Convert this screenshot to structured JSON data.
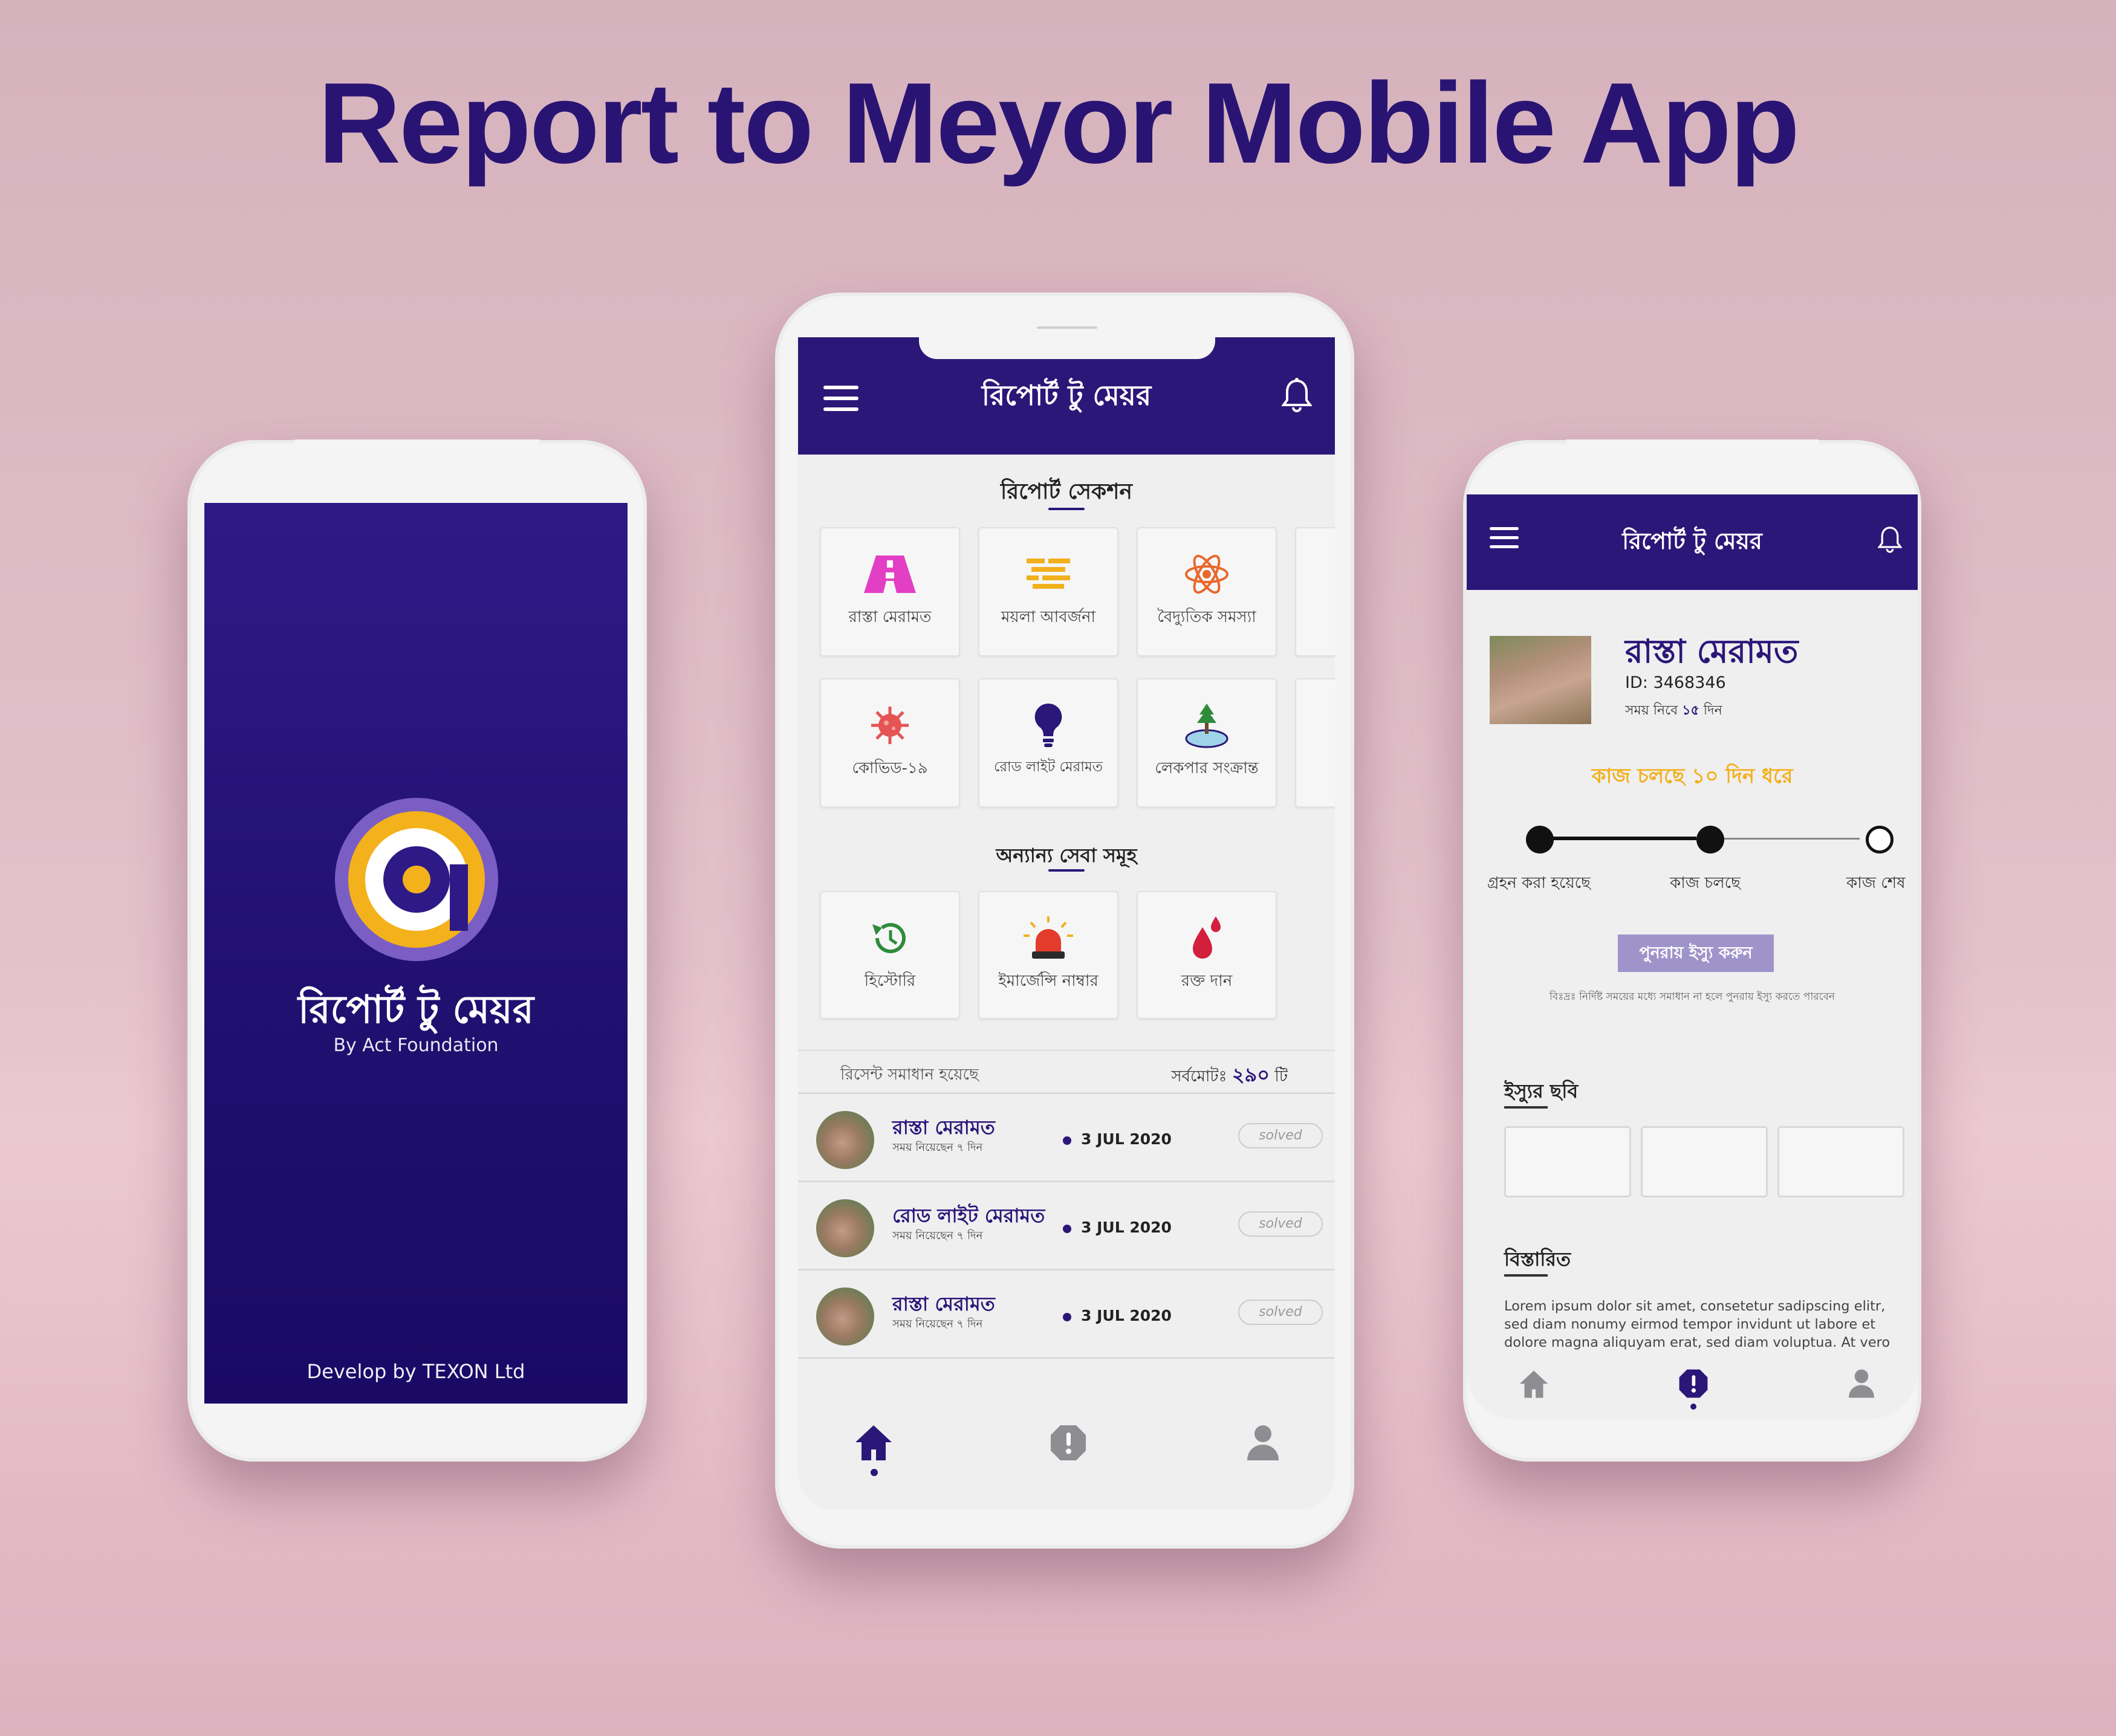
{
  "page": {
    "title": "Report to Meyor Mobile App"
  },
  "splash": {
    "app_name": "রিপোর্ট টু মেয়র",
    "by_line": "By Act Foundation",
    "developer": "Develop by TEXON Ltd",
    "colors": {
      "background": "#2e1a86",
      "logo_ring": "#f3b11b"
    }
  },
  "home": {
    "app_title": "রিপোর্ট টু মেয়র",
    "report_section_title": "রিপোর্ট সেকশন",
    "report_tiles": [
      {
        "label": "রাস্তা মেরামত",
        "icon": "road-icon"
      },
      {
        "label": "ময়লা আবর্জনা",
        "icon": "garbage-icon"
      },
      {
        "label": "বৈদ্যুতিক সমস্যা",
        "icon": "electric-atom-icon"
      },
      {
        "label": "কোভিড-১৯",
        "icon": "virus-icon"
      },
      {
        "label": "রোড লাইট মেরামত",
        "icon": "bulb-icon"
      },
      {
        "label": "লেকপার সংক্রান্ত",
        "icon": "lake-tree-icon"
      }
    ],
    "other_section_title": "অন্যান্য সেবা সমূহ",
    "other_tiles": [
      {
        "label": "হিস্টোরি",
        "icon": "history-icon"
      },
      {
        "label": "ইমার্জেন্সি নাম্বার",
        "icon": "siren-icon"
      },
      {
        "label": "রক্ত দান",
        "icon": "blood-drop-icon"
      }
    ],
    "recent_label": "রিসেন্ট সমাধান হয়েছে",
    "total_label": "সর্বমোটঃ",
    "total_value": "২৯০",
    "total_unit": "টি",
    "recent_items": [
      {
        "name": "রাস্তা মেরামত",
        "sub": "সময় নিয়েছেন ৭ দিন",
        "date": "3 JUL 2020",
        "status": "solved"
      },
      {
        "name": "রোড লাইট মেরামত",
        "sub": "সময় নিয়েছেন ৭ দিন",
        "date": "3 JUL 2020",
        "status": "solved"
      },
      {
        "name": "রাস্তা মেরামত",
        "sub": "সময় নিয়েছেন ৭ দিন",
        "date": "3 JUL 2020",
        "status": "solved"
      }
    ],
    "colors": {
      "primary": "#2b1778"
    }
  },
  "detail": {
    "app_title": "রিপোর্ট টু মেয়র",
    "issue_name": "রাস্তা মেরামত",
    "issue_id": "ID: 3468346",
    "time_label": "সময় নিবে",
    "time_value": "১৫",
    "time_unit": "দিন",
    "status_text": "কাজ চলছে ১০ দিন ধরে",
    "steps": [
      {
        "label": "গ্রহন করা হয়েছে",
        "done": true
      },
      {
        "label": "কাজ চলছে",
        "done": true
      },
      {
        "label": "কাজ শেষ",
        "done": false
      }
    ],
    "reissue_label": "পুনরায় ইস্যু করুন",
    "reissue_note": "বিঃদ্রঃ নির্দিষ্ট সময়ের মধ্যে সমাধান না হলে পুনরায় ইস্যু করতে পারবেন",
    "photos_label": "ইস্যুর ছবি",
    "details_label": "বিস্তারিত",
    "details_text": "Lorem ipsum dolor sit amet, consetetur sadipscing elitr, sed diam nonumy eirmod tempor invidunt ut labore et dolore magna aliquyam erat, sed diam voluptua. At vero eos et accusam et justo duo dolores et ea rebum. Stet clita kasd gubergren, no sea takimata sanctus est Lorem ipsum dolor sit amet. Lorem ipsum dolor sit amet, consetetur sadipscing elitr,",
    "colors": {
      "status": "#f2b01c",
      "button": "#9f94c9"
    }
  }
}
